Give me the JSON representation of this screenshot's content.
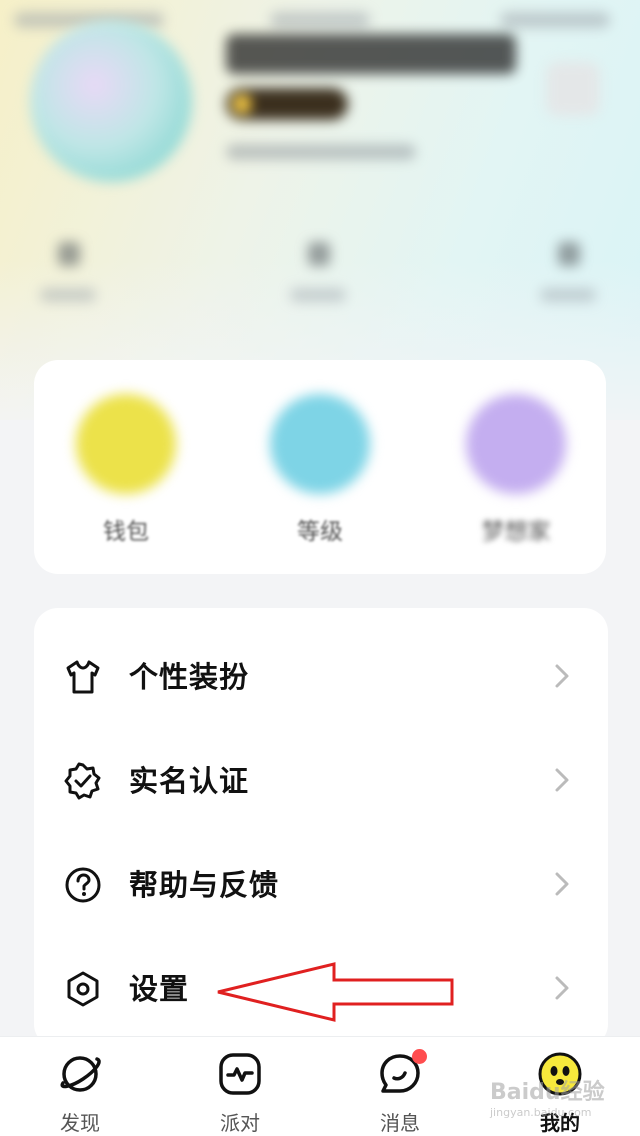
{
  "profile": {
    "stats": [
      {
        "name": "stat-left"
      },
      {
        "name": "stat-middle"
      },
      {
        "name": "stat-right"
      }
    ]
  },
  "quick_actions": [
    {
      "label": "钱包",
      "color": "#ece24a"
    },
    {
      "label": "等级",
      "color": "#7ed4e6"
    },
    {
      "label": "梦想家",
      "color": "#c4aef0"
    }
  ],
  "menu": {
    "items": [
      {
        "label": "个性装扮",
        "icon": "shirt-icon"
      },
      {
        "label": "实名认证",
        "icon": "verified-badge-icon"
      },
      {
        "label": "帮助与反馈",
        "icon": "help-icon"
      },
      {
        "label": "设置",
        "icon": "settings-icon"
      }
    ]
  },
  "tabs": [
    {
      "label": "发现",
      "icon": "planet-icon",
      "active": false
    },
    {
      "label": "派对",
      "icon": "pulse-icon",
      "active": false
    },
    {
      "label": "消息",
      "icon": "chat-icon",
      "active": false,
      "has_notification": true
    },
    {
      "label": "我的",
      "icon": "avatar-icon",
      "active": true
    }
  ],
  "watermark": {
    "text": "Baidu经验",
    "sub": "jingyan.baidu.com"
  },
  "colors": {
    "accent_red": "#ff4d4f",
    "annotation_red": "#e02020",
    "page_bg": "#f3f4f6"
  }
}
